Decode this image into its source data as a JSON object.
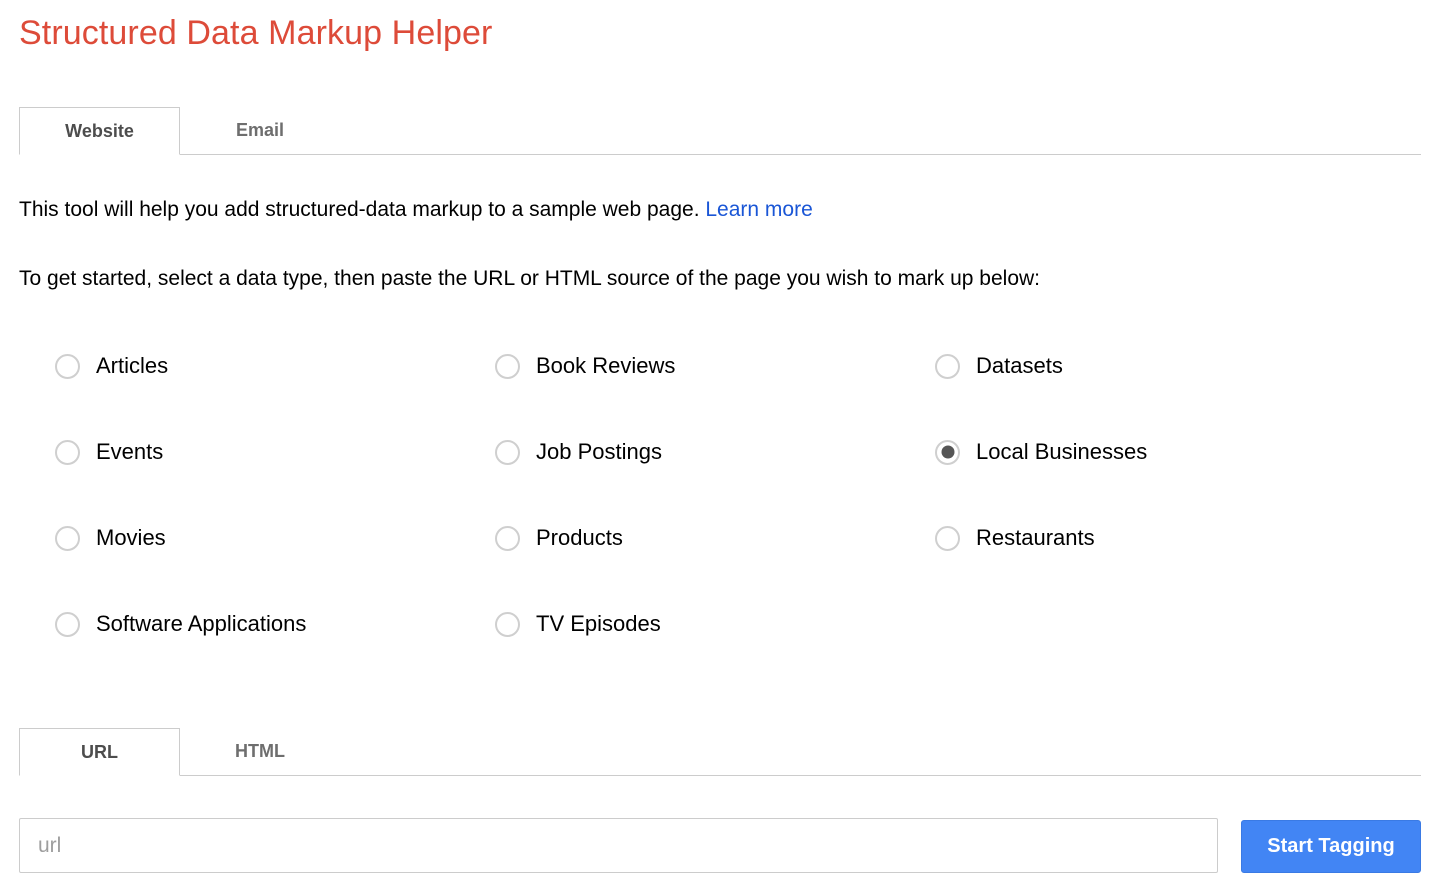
{
  "app": {
    "title": "Structured Data Markup Helper",
    "title_color": "#dd4b39"
  },
  "source_tabs": {
    "items": [
      {
        "label": "Website",
        "active": true
      },
      {
        "label": "Email",
        "active": false
      }
    ]
  },
  "intro": {
    "line1_text": "This tool will help you add structured-data markup to a sample web page.",
    "line1_link": "Learn more",
    "line1_link_color": "#1a56d6",
    "line2": "To get started, select a data type, then paste the URL or HTML source of the page you wish to mark up below:"
  },
  "data_types": {
    "selected": "Local Businesses",
    "rows": [
      [
        {
          "label": "Articles",
          "checked": false
        },
        {
          "label": "Book Reviews",
          "checked": false
        },
        {
          "label": "Datasets",
          "checked": false
        }
      ],
      [
        {
          "label": "Events",
          "checked": false
        },
        {
          "label": "Job Postings",
          "checked": false
        },
        {
          "label": "Local Businesses",
          "checked": true
        }
      ],
      [
        {
          "label": "Movies",
          "checked": false
        },
        {
          "label": "Products",
          "checked": false
        },
        {
          "label": "Restaurants",
          "checked": false
        }
      ],
      [
        {
          "label": "Software Applications",
          "checked": false
        },
        {
          "label": "TV Episodes",
          "checked": false
        }
      ]
    ]
  },
  "input_tabs": {
    "items": [
      {
        "label": "URL",
        "active": true
      },
      {
        "label": "HTML",
        "active": false
      }
    ]
  },
  "url_field": {
    "value": "",
    "placeholder": "url"
  },
  "actions": {
    "start_tagging_label": "Start Tagging",
    "start_tagging_color": "#4285f4"
  }
}
